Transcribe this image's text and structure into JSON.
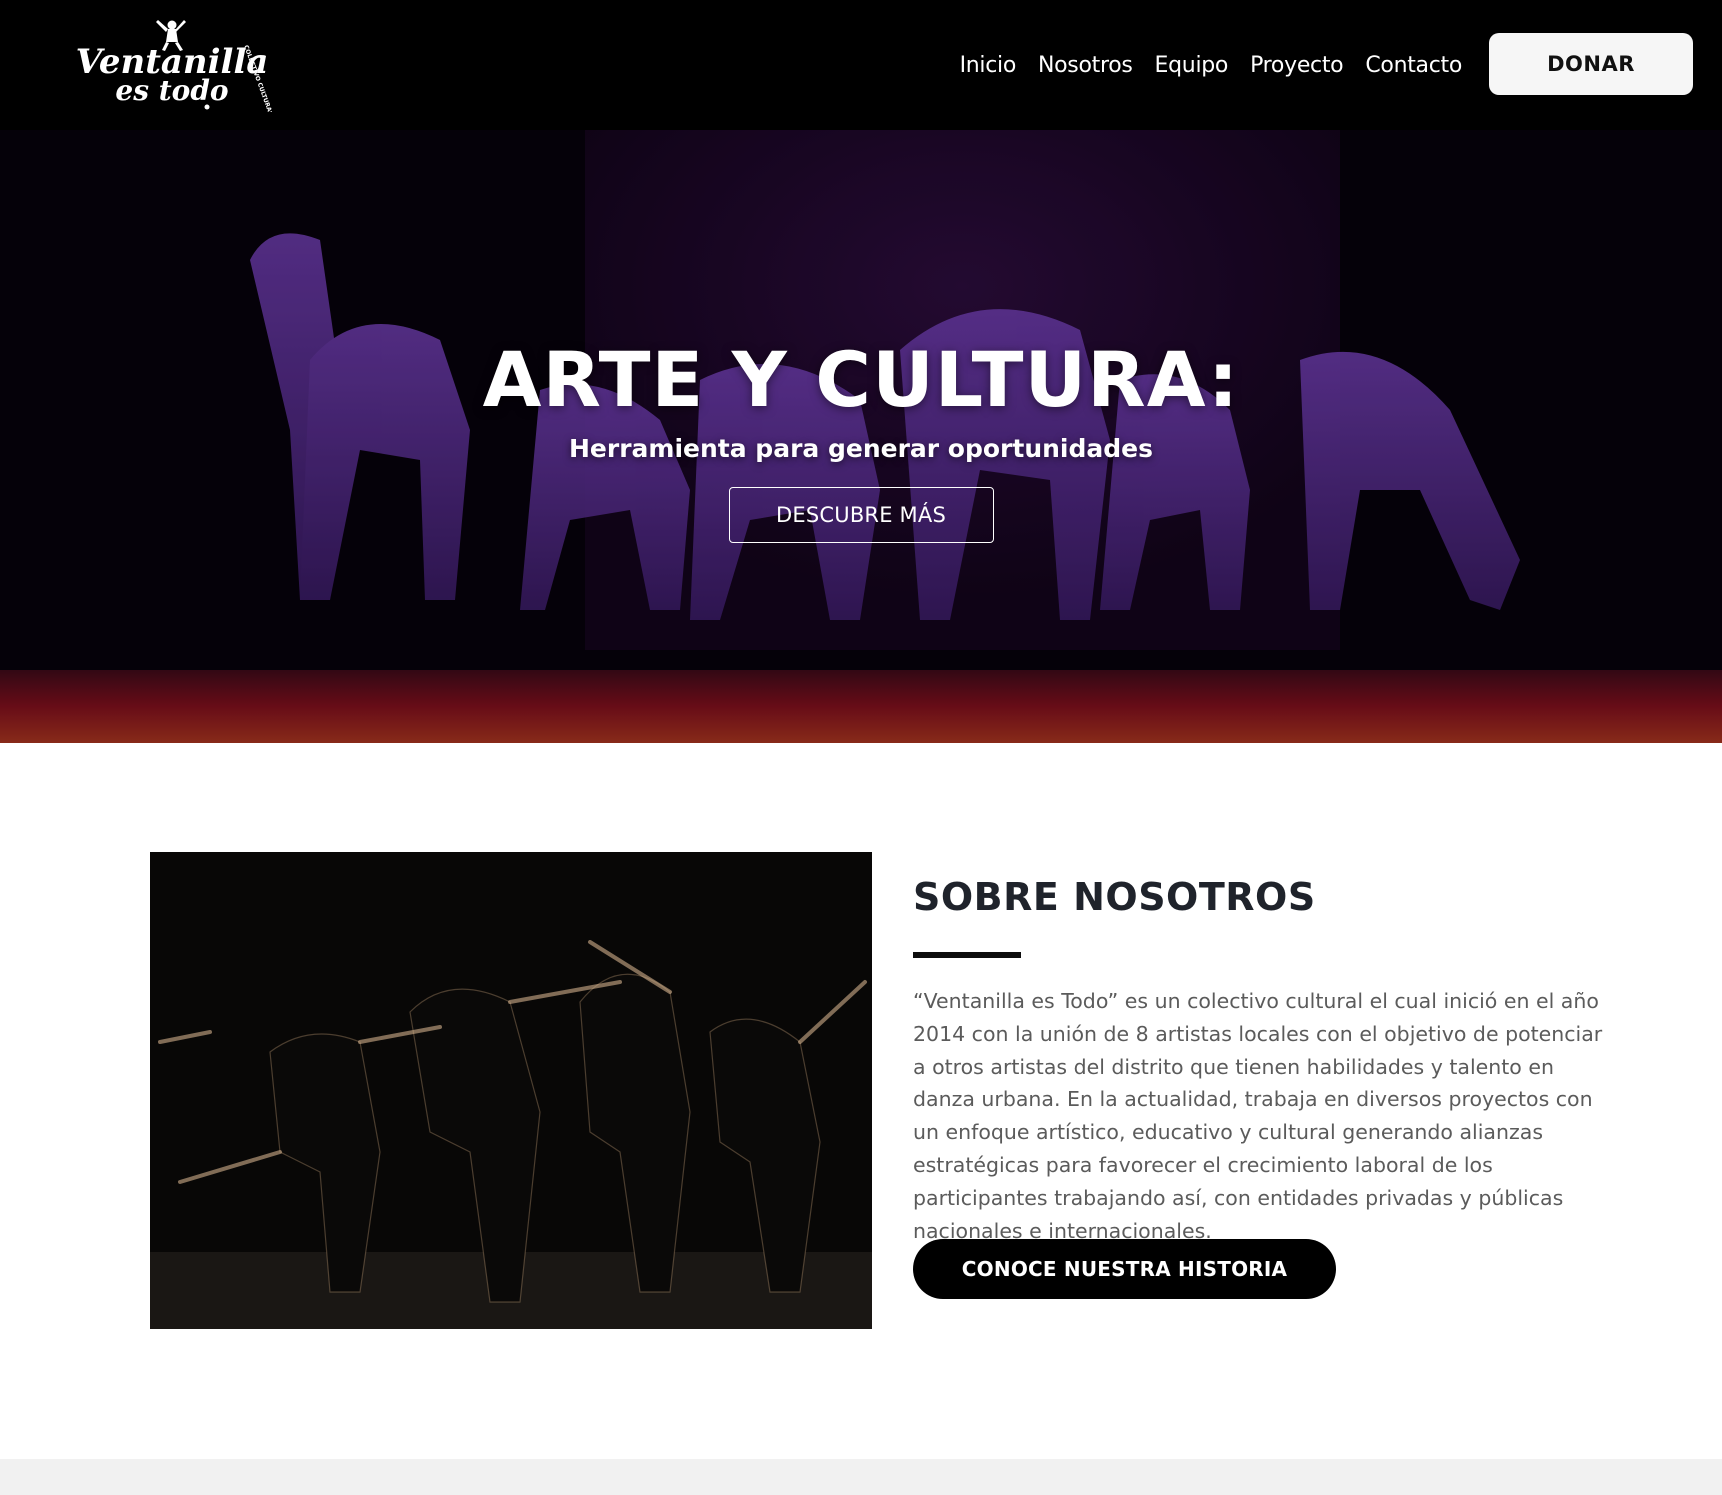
{
  "header": {
    "logo": {
      "line1": "Ventanilla",
      "line2": "es todo",
      "tagline": "COLECTIVO CULTURAL"
    },
    "nav": [
      "Inicio",
      "Nosotros",
      "Equipo",
      "Proyecto",
      "Contacto"
    ],
    "donate_label": "DONAR"
  },
  "hero": {
    "title": "ARTE Y CULTURA:",
    "subtitle": "Herramienta para generar oportunidades",
    "cta_label": "DESCUBRE MÁS"
  },
  "about": {
    "title": "SOBRE NOSOTROS",
    "body": "“Ventanilla es Todo” es un colectivo cultural el cual inició en el año 2014 con la unión de 8 artistas locales con el objetivo de potenciar a otros artistas del distrito que tienen habilidades y talento en danza urbana. En la actualidad, trabaja en diversos proyectos con un enfoque artístico, educativo y cultural generando alianzas estratégicas para favorecer el crecimiento laboral de los participantes trabajando así, con entidades privadas y públicas nacionales e internacionales.",
    "cta_label": "CONOCE NUESTRA HISTORIA"
  },
  "colors": {
    "header_bg": "#000000",
    "hero_tint": "#3a1450",
    "stage_floor": "#7a0f1c",
    "button_dark": "#000000",
    "title_text": "#1f232b",
    "body_text": "#5b5b5b"
  }
}
